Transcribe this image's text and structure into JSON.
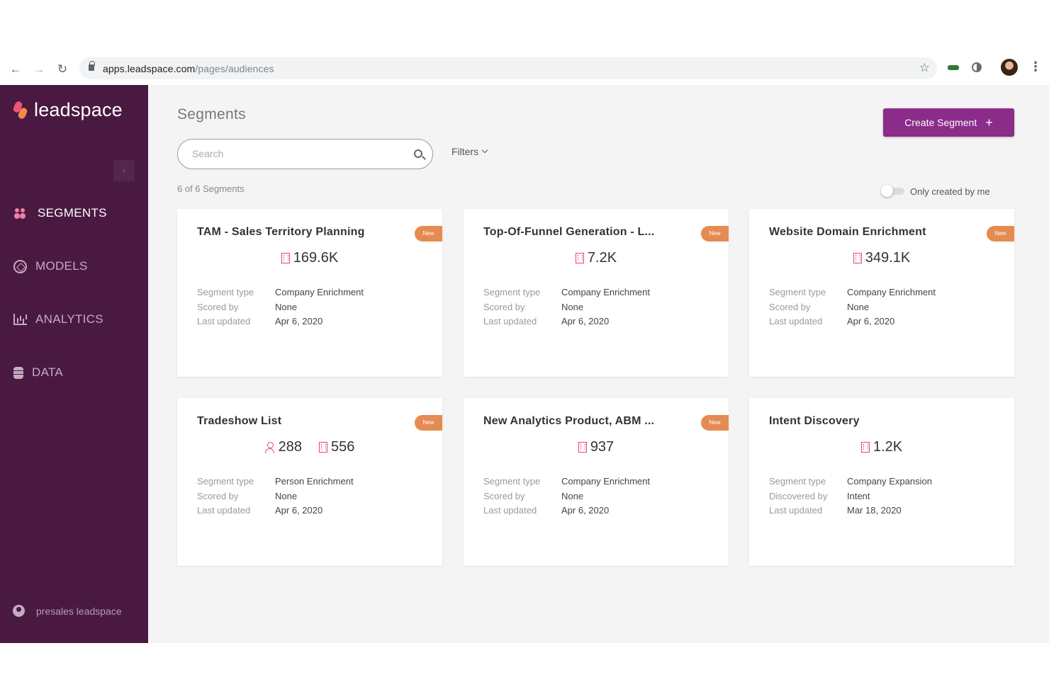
{
  "browser": {
    "url_host": "apps.leadspace.com",
    "url_path": "/pages/audiences"
  },
  "sidebar": {
    "logo_text": "leadspace",
    "collapse_glyph": "‹",
    "items": [
      {
        "label": "SEGMENTS",
        "icon": "people-icon",
        "active": true
      },
      {
        "label": "MODELS",
        "icon": "cube-icon",
        "active": false
      },
      {
        "label": "ANALYTICS",
        "icon": "bar-chart-icon",
        "active": false
      },
      {
        "label": "DATA",
        "icon": "database-icon",
        "active": false
      }
    ],
    "user": "presales leadspace"
  },
  "main": {
    "title": "Segments",
    "create_button": "Create Segment",
    "create_plus": "+",
    "search_placeholder": "Search",
    "filters_label": "Filters",
    "count_text": "6 of 6 Segments",
    "toggle_label": "Only created by me"
  },
  "colors": {
    "sidebar_bg": "#4a1942",
    "accent": "#8b2b8a",
    "badge": "#e58b52",
    "metric_icon": "#e8407a"
  },
  "segments": [
    {
      "title": "TAM - Sales Territory Planning",
      "badge": "New",
      "metrics": [
        {
          "icon": "company-icon",
          "value": "169.6K"
        }
      ],
      "meta": [
        {
          "key": "Segment type",
          "value": "Company Enrichment"
        },
        {
          "key": "Scored by",
          "value": "None"
        },
        {
          "key": "Last updated",
          "value": "Apr 6, 2020"
        }
      ]
    },
    {
      "title": "Top-Of-Funnel Generation - L...",
      "badge": "New",
      "metrics": [
        {
          "icon": "company-icon",
          "value": "7.2K"
        }
      ],
      "meta": [
        {
          "key": "Segment type",
          "value": "Company Enrichment"
        },
        {
          "key": "Scored by",
          "value": "None"
        },
        {
          "key": "Last updated",
          "value": "Apr 6, 2020"
        }
      ]
    },
    {
      "title": "Website Domain Enrichment",
      "badge": "New",
      "metrics": [
        {
          "icon": "company-icon",
          "value": "349.1K"
        }
      ],
      "meta": [
        {
          "key": "Segment type",
          "value": "Company Enrichment"
        },
        {
          "key": "Scored by",
          "value": "None"
        },
        {
          "key": "Last updated",
          "value": "Apr 6, 2020"
        }
      ]
    },
    {
      "title": "Tradeshow List",
      "badge": "New",
      "metrics": [
        {
          "icon": "person-icon",
          "value": "288"
        },
        {
          "icon": "company-icon",
          "value": "556"
        }
      ],
      "meta": [
        {
          "key": "Segment type",
          "value": "Person Enrichment"
        },
        {
          "key": "Scored by",
          "value": "None"
        },
        {
          "key": "Last updated",
          "value": "Apr 6, 2020"
        }
      ]
    },
    {
      "title": "New Analytics Product, ABM ...",
      "badge": "New",
      "metrics": [
        {
          "icon": "company-icon",
          "value": "937"
        }
      ],
      "meta": [
        {
          "key": "Segment type",
          "value": "Company Enrichment"
        },
        {
          "key": "Scored by",
          "value": "None"
        },
        {
          "key": "Last updated",
          "value": "Apr 6, 2020"
        }
      ]
    },
    {
      "title": "Intent Discovery",
      "badge": "",
      "metrics": [
        {
          "icon": "company-icon",
          "value": "1.2K"
        }
      ],
      "meta": [
        {
          "key": "Segment type",
          "value": "Company Expansion"
        },
        {
          "key": "Discovered by",
          "value": "Intent"
        },
        {
          "key": "Last updated",
          "value": "Mar 18, 2020"
        }
      ]
    }
  ]
}
